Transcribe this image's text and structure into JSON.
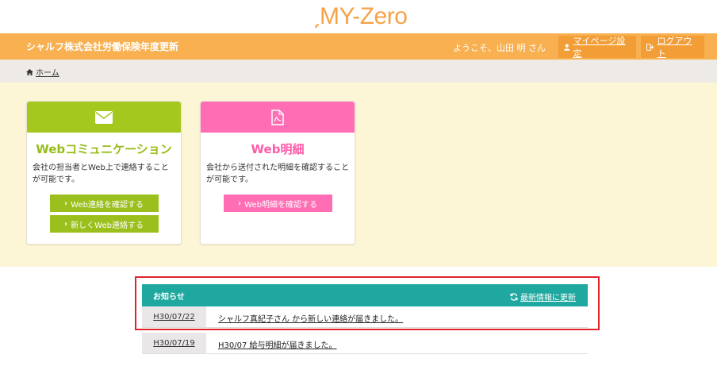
{
  "logo": {
    "text": "MY-Zero"
  },
  "header": {
    "title": "シャルフ株式会社労働保険年度更新",
    "welcome": "ようこそ、山田 明 さん",
    "mypage_label": "マイページ設定",
    "logout_label": "ログアウト",
    "bar_color": "#f8b050"
  },
  "breadcrumb": {
    "home_label": "ホーム"
  },
  "cards": {
    "web_comm": {
      "title": "Webコミュニケーション",
      "description": "会社の担当者とWeb上で連絡することが可能です。",
      "button_check": "Web連絡を確認する",
      "button_new": "新しくWeb連絡する",
      "icon": "envelope-icon",
      "color": "#a5c81f"
    },
    "web_statement": {
      "title": "Web明細",
      "description": "会社から送付された明細を確認することが可能です。",
      "button_check": "Web明細を確認する",
      "icon": "pdf-file-icon",
      "color": "#ff6eb4"
    }
  },
  "news": {
    "title": "お知らせ",
    "refresh_label": "最新情報に更新",
    "header_color": "#1fa8a0",
    "items": [
      {
        "date": "H30/07/22",
        "text": "シャルフ真紀子さん から新しい連絡が届きました。"
      },
      {
        "date": "H30/07/19",
        "text": "H30/07 給与明細が届きました。"
      }
    ]
  }
}
